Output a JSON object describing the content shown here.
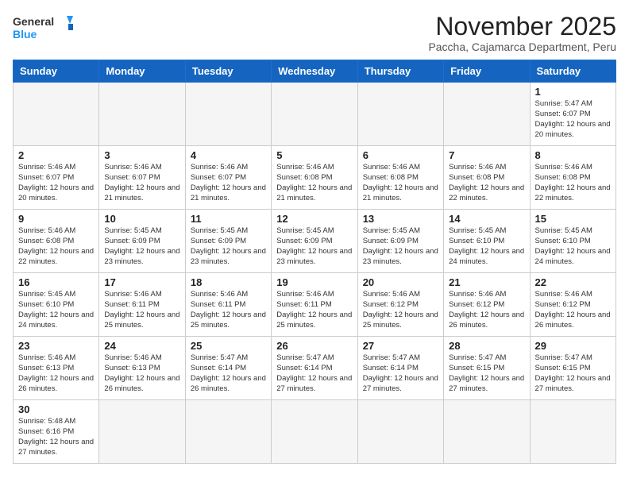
{
  "logo": {
    "text_general": "General",
    "text_blue": "Blue"
  },
  "header": {
    "title": "November 2025",
    "subtitle": "Paccha, Cajamarca Department, Peru"
  },
  "weekdays": [
    "Sunday",
    "Monday",
    "Tuesday",
    "Wednesday",
    "Thursday",
    "Friday",
    "Saturday"
  ],
  "weeks": [
    [
      {
        "day": "",
        "info": ""
      },
      {
        "day": "",
        "info": ""
      },
      {
        "day": "",
        "info": ""
      },
      {
        "day": "",
        "info": ""
      },
      {
        "day": "",
        "info": ""
      },
      {
        "day": "",
        "info": ""
      },
      {
        "day": "1",
        "info": "Sunrise: 5:47 AM\nSunset: 6:07 PM\nDaylight: 12 hours and 20 minutes."
      }
    ],
    [
      {
        "day": "2",
        "info": "Sunrise: 5:46 AM\nSunset: 6:07 PM\nDaylight: 12 hours and 20 minutes."
      },
      {
        "day": "3",
        "info": "Sunrise: 5:46 AM\nSunset: 6:07 PM\nDaylight: 12 hours and 21 minutes."
      },
      {
        "day": "4",
        "info": "Sunrise: 5:46 AM\nSunset: 6:07 PM\nDaylight: 12 hours and 21 minutes."
      },
      {
        "day": "5",
        "info": "Sunrise: 5:46 AM\nSunset: 6:08 PM\nDaylight: 12 hours and 21 minutes."
      },
      {
        "day": "6",
        "info": "Sunrise: 5:46 AM\nSunset: 6:08 PM\nDaylight: 12 hours and 21 minutes."
      },
      {
        "day": "7",
        "info": "Sunrise: 5:46 AM\nSunset: 6:08 PM\nDaylight: 12 hours and 22 minutes."
      },
      {
        "day": "8",
        "info": "Sunrise: 5:46 AM\nSunset: 6:08 PM\nDaylight: 12 hours and 22 minutes."
      }
    ],
    [
      {
        "day": "9",
        "info": "Sunrise: 5:46 AM\nSunset: 6:08 PM\nDaylight: 12 hours and 22 minutes."
      },
      {
        "day": "10",
        "info": "Sunrise: 5:45 AM\nSunset: 6:09 PM\nDaylight: 12 hours and 23 minutes."
      },
      {
        "day": "11",
        "info": "Sunrise: 5:45 AM\nSunset: 6:09 PM\nDaylight: 12 hours and 23 minutes."
      },
      {
        "day": "12",
        "info": "Sunrise: 5:45 AM\nSunset: 6:09 PM\nDaylight: 12 hours and 23 minutes."
      },
      {
        "day": "13",
        "info": "Sunrise: 5:45 AM\nSunset: 6:09 PM\nDaylight: 12 hours and 23 minutes."
      },
      {
        "day": "14",
        "info": "Sunrise: 5:45 AM\nSunset: 6:10 PM\nDaylight: 12 hours and 24 minutes."
      },
      {
        "day": "15",
        "info": "Sunrise: 5:45 AM\nSunset: 6:10 PM\nDaylight: 12 hours and 24 minutes."
      }
    ],
    [
      {
        "day": "16",
        "info": "Sunrise: 5:45 AM\nSunset: 6:10 PM\nDaylight: 12 hours and 24 minutes."
      },
      {
        "day": "17",
        "info": "Sunrise: 5:46 AM\nSunset: 6:11 PM\nDaylight: 12 hours and 25 minutes."
      },
      {
        "day": "18",
        "info": "Sunrise: 5:46 AM\nSunset: 6:11 PM\nDaylight: 12 hours and 25 minutes."
      },
      {
        "day": "19",
        "info": "Sunrise: 5:46 AM\nSunset: 6:11 PM\nDaylight: 12 hours and 25 minutes."
      },
      {
        "day": "20",
        "info": "Sunrise: 5:46 AM\nSunset: 6:12 PM\nDaylight: 12 hours and 25 minutes."
      },
      {
        "day": "21",
        "info": "Sunrise: 5:46 AM\nSunset: 6:12 PM\nDaylight: 12 hours and 26 minutes."
      },
      {
        "day": "22",
        "info": "Sunrise: 5:46 AM\nSunset: 6:12 PM\nDaylight: 12 hours and 26 minutes."
      }
    ],
    [
      {
        "day": "23",
        "info": "Sunrise: 5:46 AM\nSunset: 6:13 PM\nDaylight: 12 hours and 26 minutes."
      },
      {
        "day": "24",
        "info": "Sunrise: 5:46 AM\nSunset: 6:13 PM\nDaylight: 12 hours and 26 minutes."
      },
      {
        "day": "25",
        "info": "Sunrise: 5:47 AM\nSunset: 6:14 PM\nDaylight: 12 hours and 26 minutes."
      },
      {
        "day": "26",
        "info": "Sunrise: 5:47 AM\nSunset: 6:14 PM\nDaylight: 12 hours and 27 minutes."
      },
      {
        "day": "27",
        "info": "Sunrise: 5:47 AM\nSunset: 6:14 PM\nDaylight: 12 hours and 27 minutes."
      },
      {
        "day": "28",
        "info": "Sunrise: 5:47 AM\nSunset: 6:15 PM\nDaylight: 12 hours and 27 minutes."
      },
      {
        "day": "29",
        "info": "Sunrise: 5:47 AM\nSunset: 6:15 PM\nDaylight: 12 hours and 27 minutes."
      }
    ],
    [
      {
        "day": "30",
        "info": "Sunrise: 5:48 AM\nSunset: 6:16 PM\nDaylight: 12 hours and 27 minutes."
      },
      {
        "day": "",
        "info": ""
      },
      {
        "day": "",
        "info": ""
      },
      {
        "day": "",
        "info": ""
      },
      {
        "day": "",
        "info": ""
      },
      {
        "day": "",
        "info": ""
      },
      {
        "day": "",
        "info": ""
      }
    ]
  ]
}
